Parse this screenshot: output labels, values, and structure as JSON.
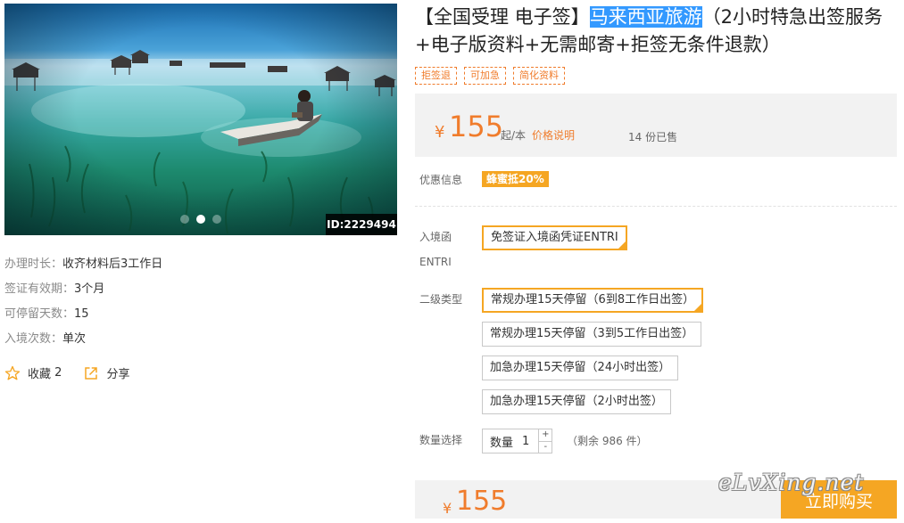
{
  "product": {
    "title_prefix": "【全国受理 电子签】",
    "title_highlight": "马来西亚旅游",
    "title_suffix": "（2小时特急出签服务+电子版资料+无需邮寄+拒签无条件退款）",
    "tags": [
      "拒签退",
      "可加急",
      "简化资料"
    ]
  },
  "gallery": {
    "image_id": "ID:2229494",
    "dots": 3,
    "active_dot": 2
  },
  "price": {
    "currency": "¥",
    "amount": "155",
    "unit": "起/本",
    "explain_link": "价格说明",
    "sold": "14 份已售"
  },
  "promo": {
    "label": "优惠信息",
    "badge": "蜂蜜抵20%"
  },
  "entry_letter": {
    "label_line1": "入境函",
    "label_line2": "ENTRI",
    "options": [
      "免签证入境函凭证ENTRI"
    ],
    "selected": 0
  },
  "sub_type": {
    "label": "二级类型",
    "options": [
      "常规办理15天停留（6到8工作日出签）",
      "常规办理15天停留（3到5工作日出签）",
      "加急办理15天停留（24小时出签）",
      "加急办理15天停留（2小时出签）"
    ],
    "selected": 0
  },
  "quantity": {
    "label": "数量选择",
    "field_label": "数量",
    "value": "1",
    "plus": "+",
    "minus": "-",
    "stock": "（剩余 986 件）"
  },
  "info": [
    {
      "label": "办理时长：",
      "value": "收齐材料后3工作日"
    },
    {
      "label": "签证有效期：",
      "value": "3个月"
    },
    {
      "label": "可停留天数：",
      "value": "15"
    },
    {
      "label": "入境次数：",
      "value": "单次"
    }
  ],
  "actions": {
    "favorite_label": "收藏",
    "favorite_count": "2",
    "share_label": "分享"
  },
  "bottom": {
    "currency": "¥",
    "amount": "155",
    "buy_label": "立即购买"
  },
  "watermark": "eLvXing.net",
  "colors": {
    "accent": "#f07c2c",
    "badge": "#f5a623",
    "highlight": "#3399ff"
  }
}
